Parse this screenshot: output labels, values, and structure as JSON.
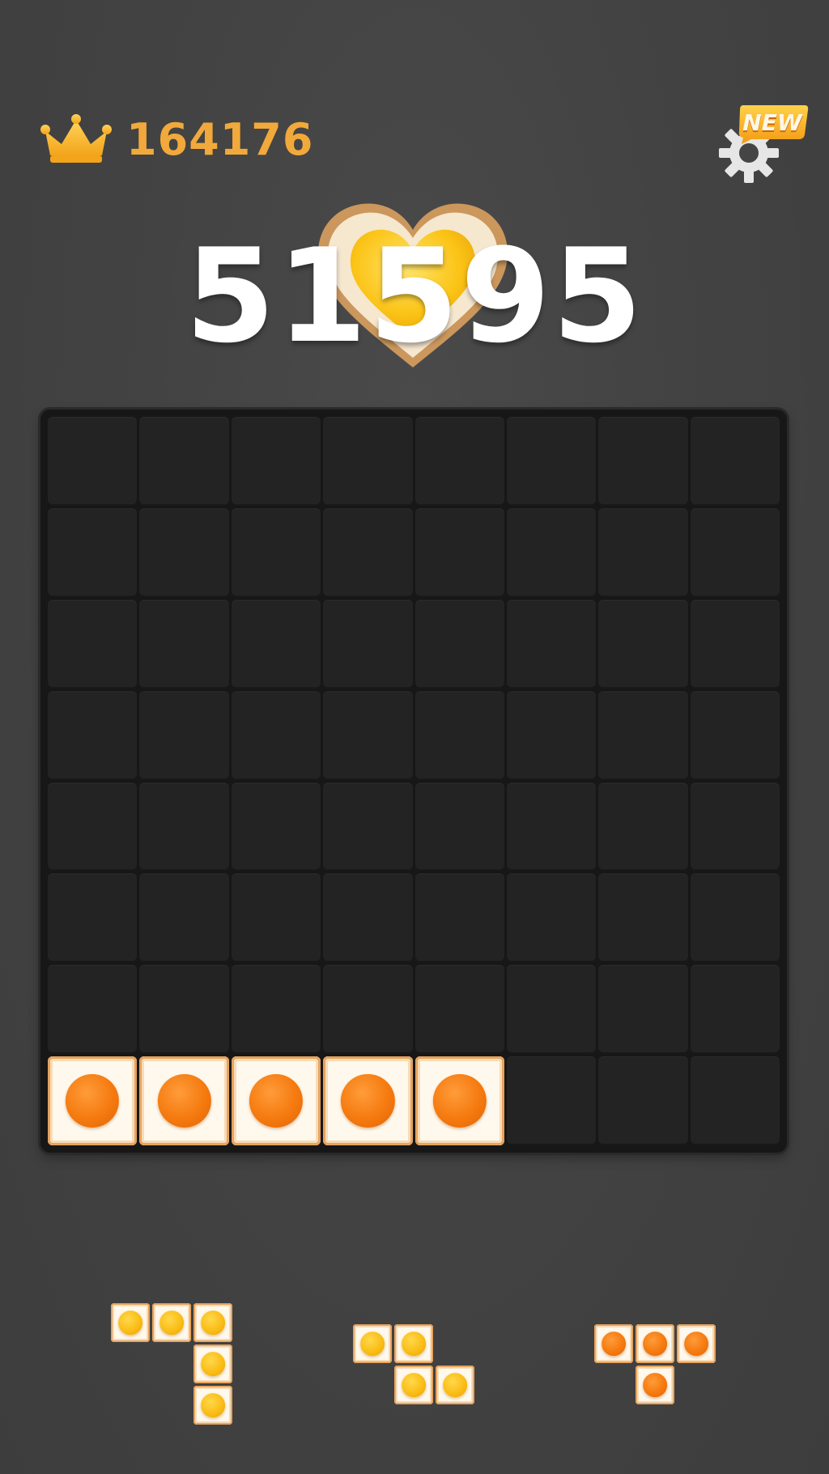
{
  "hud": {
    "best_score": "164176",
    "best_icon": "crown-icon",
    "settings_icon": "gear-icon",
    "new_badge": "NEW"
  },
  "score": {
    "current": "51595",
    "emblem": "fried-egg-heart-icon"
  },
  "board": {
    "rows": 8,
    "cols": 8,
    "filled_cells": [
      {
        "row": 7,
        "col": 0,
        "egg": "orange"
      },
      {
        "row": 7,
        "col": 1,
        "egg": "orange"
      },
      {
        "row": 7,
        "col": 2,
        "egg": "orange"
      },
      {
        "row": 7,
        "col": 3,
        "egg": "orange"
      },
      {
        "row": 7,
        "col": 4,
        "egg": "orange"
      }
    ]
  },
  "tray": [
    {
      "name": "piece-l-shape",
      "egg": "yellow",
      "cells": [
        [
          0,
          0
        ],
        [
          0,
          1
        ],
        [
          0,
          2
        ],
        [
          1,
          2
        ],
        [
          2,
          2
        ]
      ]
    },
    {
      "name": "piece-z-shape",
      "egg": "yellow",
      "cells": [
        [
          0,
          0
        ],
        [
          0,
          1
        ],
        [
          1,
          1
        ],
        [
          1,
          2
        ]
      ]
    },
    {
      "name": "piece-t-shape",
      "egg": "orange",
      "cells": [
        [
          0,
          0
        ],
        [
          0,
          1
        ],
        [
          0,
          2
        ],
        [
          1,
          1
        ]
      ]
    }
  ],
  "colors": {
    "background": "#414141",
    "board": "#171717",
    "cell": "#232323",
    "best_score": "#f2a93b",
    "score": "#ffffff"
  }
}
